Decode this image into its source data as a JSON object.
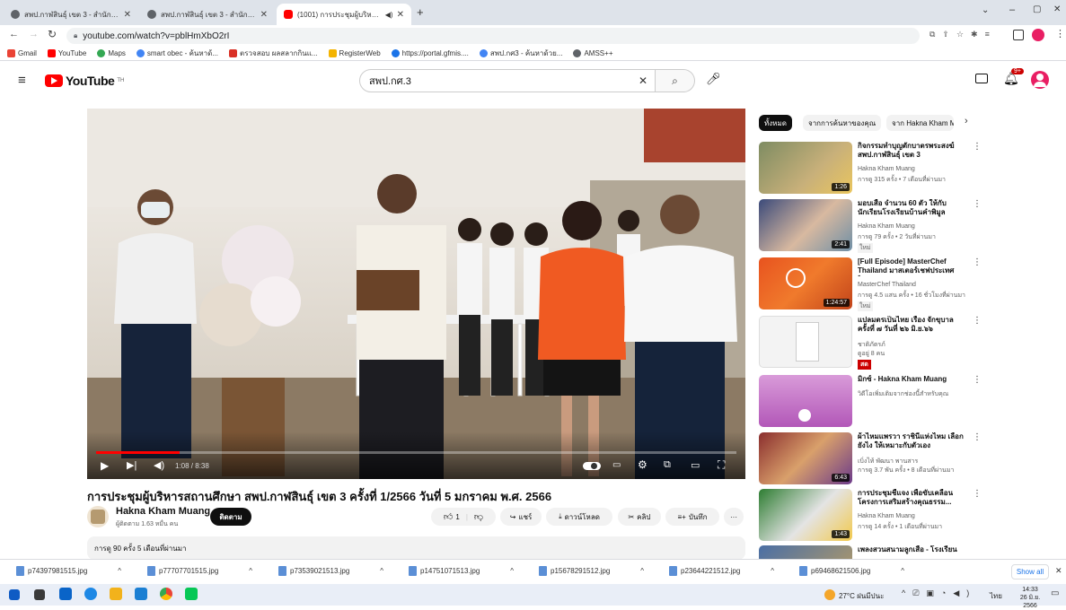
{
  "browser": {
    "tabs": [
      {
        "label": "สพป.กาฬสินธุ์ เขต 3 - สำนักงานเขตพื้...",
        "icon": "globe-icon"
      },
      {
        "label": "สพป.กาฬสินธุ์ เขต 3 - สำนักงานเขตพื้...",
        "icon": "globe-icon"
      },
      {
        "label": "(1001) การประชุมผู้บริหารสถานศึ...",
        "icon": "youtube-icon"
      }
    ],
    "new_tab": "+",
    "url": "youtube.com/watch?v=pblHmXbO2rI",
    "bookmarks": [
      "Gmail",
      "YouTube",
      "Maps",
      "smart obec - ค้นหาด้...",
      "ตรวจสอบ ผลสลากกินแ...",
      "RegisterWeb",
      "https://portal.gfmis....",
      "สพป.กศ3 - ค้นหาด้วย...",
      "AMSS++"
    ]
  },
  "youtube": {
    "logo": "YouTube",
    "logo_sup": "TH",
    "search_value": "สพป.กศ.3",
    "notif_count": "9+",
    "accent": "#ff0000"
  },
  "player": {
    "time": "1:08 / 8:38",
    "progress": 0.13
  },
  "video": {
    "title": "การประชุมผู้บริหารสถานศึกษา สพป.กาฬสินธุ์ เขต 3 ครั้งที่ 1/2566 วันที่ 5 มกราคม พ.ศ. 2566",
    "channel": "Hakna Kham Muang",
    "subscribers": "ผู้ติดตาม 1.63 หมื่น คน",
    "subscribe": "ติดตาม",
    "likes": "1",
    "share": "แชร์",
    "download": "ดาวน์โหลด",
    "clip": "คลิป",
    "save": "บันทึก",
    "more": "···",
    "meta": "การดู 90 ครั้ง  5 เดือนที่ผ่านมา"
  },
  "chips": [
    "ทั้งหมด",
    "จากการค้นหาของคุณ",
    "จาก Hakna Kham Muang"
  ],
  "recs": [
    {
      "title": "กิจกรรมทำบุญตักบาตรพระสงฆ์ สพป.กาฬสินธุ์ เขต 3",
      "channel": "Hakna Kham Muang",
      "meta": "การดู 315 ครั้ง • 7 เดือนที่ผ่านมา",
      "dur": "1:26",
      "badge": ""
    },
    {
      "title": "มอบเสื้อ จำนวน 60 ตัว ให้กับนักเรียนโรงเรียนบ้านคำพิมูล",
      "channel": "Hakna Kham Muang",
      "meta": "การดู 79 ครั้ง • 2 วันที่ผ่านมา",
      "dur": "2:41",
      "badge": "ใหม่"
    },
    {
      "title": "[Full Episode] MasterChef Thailand มาสเตอร์เชฟประเทศไ...",
      "channel": "MasterChef Thailand",
      "meta": "การดู 4.5 แสน ครั้ง • 16 ชั่วโมงที่ผ่านมา",
      "dur": "1:24:57",
      "badge": "ใหม่"
    },
    {
      "title": "แปลมตรเป็นไทย เรื่อง จักขุบาล ครั้งที่ ๗ วันที่ ๒๖ มิ.ย.๖๖",
      "channel": "ชาติภัตรภ์",
      "meta": "ดูอยู่ 8 คน",
      "dur": "",
      "badge": "สด"
    },
    {
      "title": "มิกซ์ - Hakna Kham Muang",
      "channel": "วิดีโอเพิ่มเติมจากช่องนี้สำหรับคุณ",
      "meta": "",
      "dur": "",
      "badge": ""
    },
    {
      "title": "ผ้าไหมแพรวา ราชินีแห่งไหม เลือกยังไง ให้เหมาะกับตัวเอง",
      "channel": "เบิ่งไท้ พัฒนา พานสาร",
      "meta": "การดู 3.7 พัน ครั้ง • 8 เดือนที่ผ่านมา",
      "dur": "6:43",
      "badge": ""
    },
    {
      "title": "การประชุมชี้แจง เพื่อขับเคลื่อนโครงการเสริมสร้างคุณธรรม...",
      "channel": "Hakna Kham Muang",
      "meta": "การดู 14 ครั้ง • 1 เดือนที่ผ่านมา",
      "dur": "1:43",
      "badge": ""
    },
    {
      "title": "เพลงสวนสนามลูกเสือ - โรงเรียน",
      "channel": "",
      "meta": "",
      "dur": "",
      "badge": ""
    }
  ],
  "downloads": [
    "p74397981515.jpg",
    "p77707701515.jpg",
    "p73539021513.jpg",
    "p14751071513.jpg",
    "p15678291512.jpg",
    "p23644221512.jpg",
    "p69468621506.jpg"
  ],
  "show_all": "Show all",
  "taskbar": {
    "weather": "27°C  ฝนมีปนะ",
    "lang": "ไทย",
    "time": "14:33",
    "date": "26 มิ.ย. 2566"
  }
}
